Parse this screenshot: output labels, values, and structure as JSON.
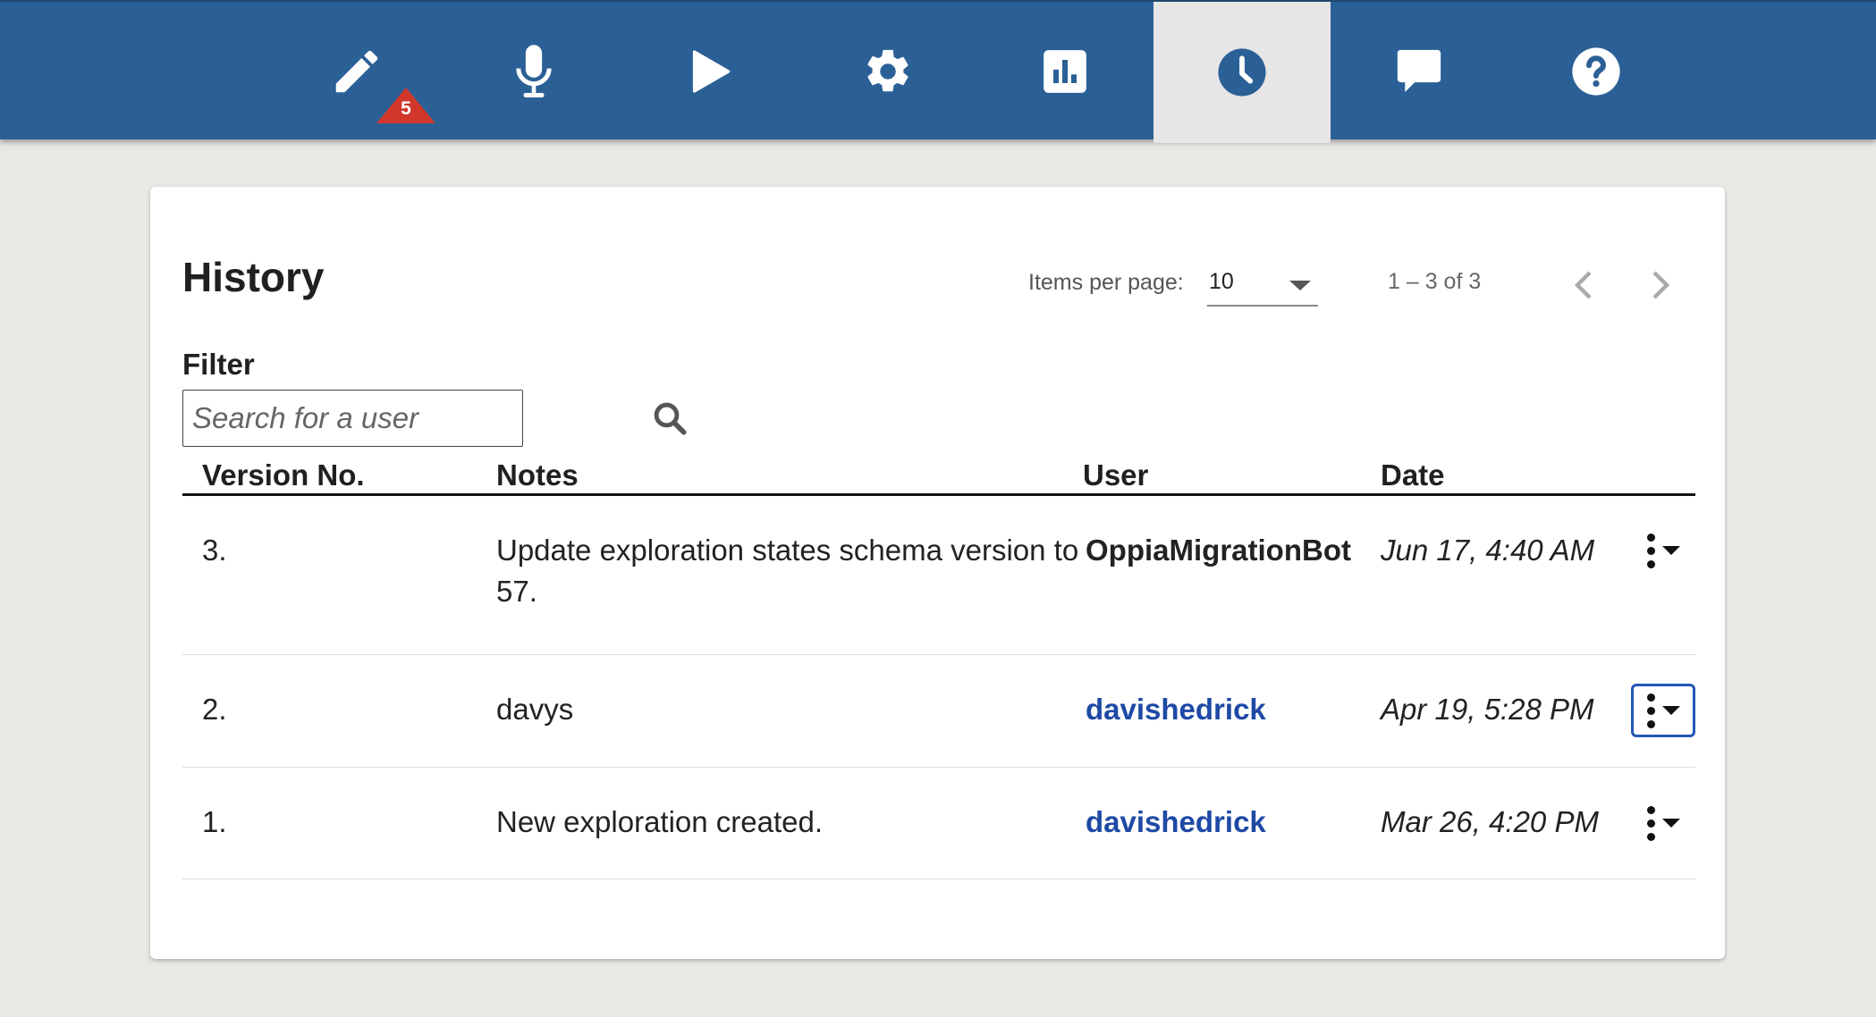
{
  "nav": {
    "tabs": [
      {
        "name": "editor",
        "icon": "pencil-icon",
        "badge": "5"
      },
      {
        "name": "translation",
        "icon": "microphone-icon"
      },
      {
        "name": "preview",
        "icon": "play-icon"
      },
      {
        "name": "settings",
        "icon": "gear-icon"
      },
      {
        "name": "statistics",
        "icon": "bar-chart-icon"
      },
      {
        "name": "history",
        "icon": "clock-icon",
        "active": true
      },
      {
        "name": "feedback",
        "icon": "speech-bubble-icon"
      },
      {
        "name": "help",
        "icon": "question-circle-icon"
      }
    ],
    "badge_count": "5"
  },
  "history": {
    "title": "History",
    "items_per_page_label": "Items per page:",
    "items_per_page_value": "10",
    "range_label": "1 – 3 of 3",
    "filter_label": "Filter",
    "search_placeholder": "Search for a user",
    "columns": [
      "Version No.",
      "Notes",
      "User",
      "Date"
    ],
    "rows": [
      {
        "version": "3.",
        "notes": "Update exploration states schema version to 57.",
        "user": "OppiaMigrationBot",
        "date": "Jun 17, 4:40 AM"
      },
      {
        "version": "2.",
        "notes": "davys",
        "user": "davishedrick",
        "date": "Apr 19, 5:28 PM"
      },
      {
        "version": "1.",
        "notes": "New exploration created.",
        "user": "davishedrick",
        "date": "Mar 26, 4:20 PM"
      }
    ]
  },
  "colors": {
    "navbar": "#2b6096",
    "active_tab": "#e6e6e6",
    "link": "#1e49a5",
    "badge": "#d2372b",
    "background": "#e9e8e5"
  }
}
